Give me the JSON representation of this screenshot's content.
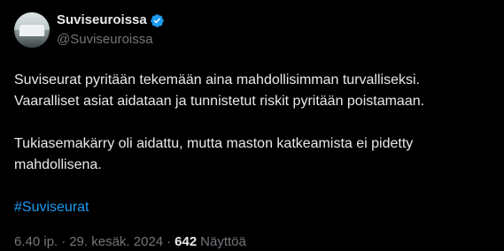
{
  "author": {
    "display_name": "Suviseuroissa",
    "handle": "@Suviseuroissa",
    "verified": true,
    "verified_color": "#1d9bf0",
    "avatar_icon": "avatar-photo"
  },
  "tweet": {
    "line1": "Suviseurat pyritään tekemään aina mahdollisimman turvalliseksi.",
    "line2": "Vaaralliset asiat aidataan ja tunnistetut riskit pyritään poistamaan.",
    "line3": "Tukiasemakärry oli aidattu, mutta maston katkeamista ei pidetty",
    "line4": "mahdollisena.",
    "hashtag": "#Suviseurat",
    "hashtag_color": "#1d9bf0"
  },
  "meta": {
    "time": "6.40 ip.",
    "separator1": "·",
    "date": "29. kesäk. 2024",
    "separator2": "·",
    "views_count": "642",
    "views_label": "Näyttöä"
  },
  "colors": {
    "background": "#000000",
    "text_primary": "#e7e9ea",
    "text_secondary": "#71767b"
  }
}
